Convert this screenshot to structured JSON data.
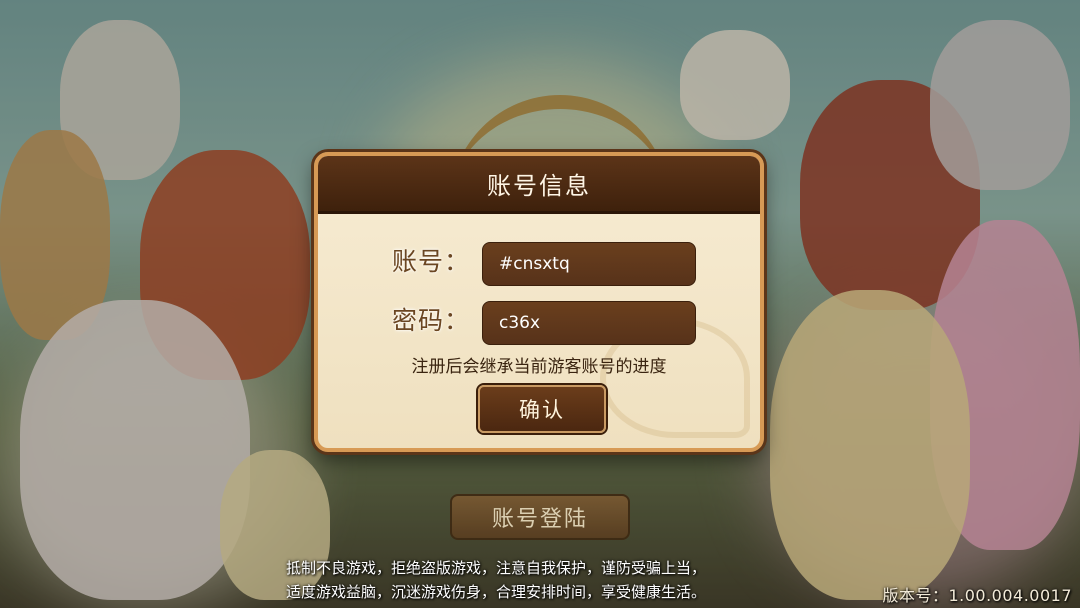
{
  "dialog": {
    "title": "账号信息",
    "account_label": "账号：",
    "account_value": "#cnsxtq",
    "password_label": "密码：",
    "password_value": "c36x",
    "hint": "注册后会继承当前游客账号的进度",
    "confirm_label": "确认"
  },
  "login_button_label": "账号登陆",
  "notice": {
    "line1": "抵制不良游戏，拒绝盗版游戏，注意自我保护，谨防受骗上当，",
    "line2": "适度游戏益脑，沉迷游戏伤身，合理安排时间，享受健康生活。"
  },
  "version": "版本号：1.00.004.0017",
  "colors": {
    "header_bg": "#4a2810",
    "dialog_bg": "#f3e6c8",
    "input_bg": "#5f381b",
    "border_accent": "#d79a55"
  }
}
